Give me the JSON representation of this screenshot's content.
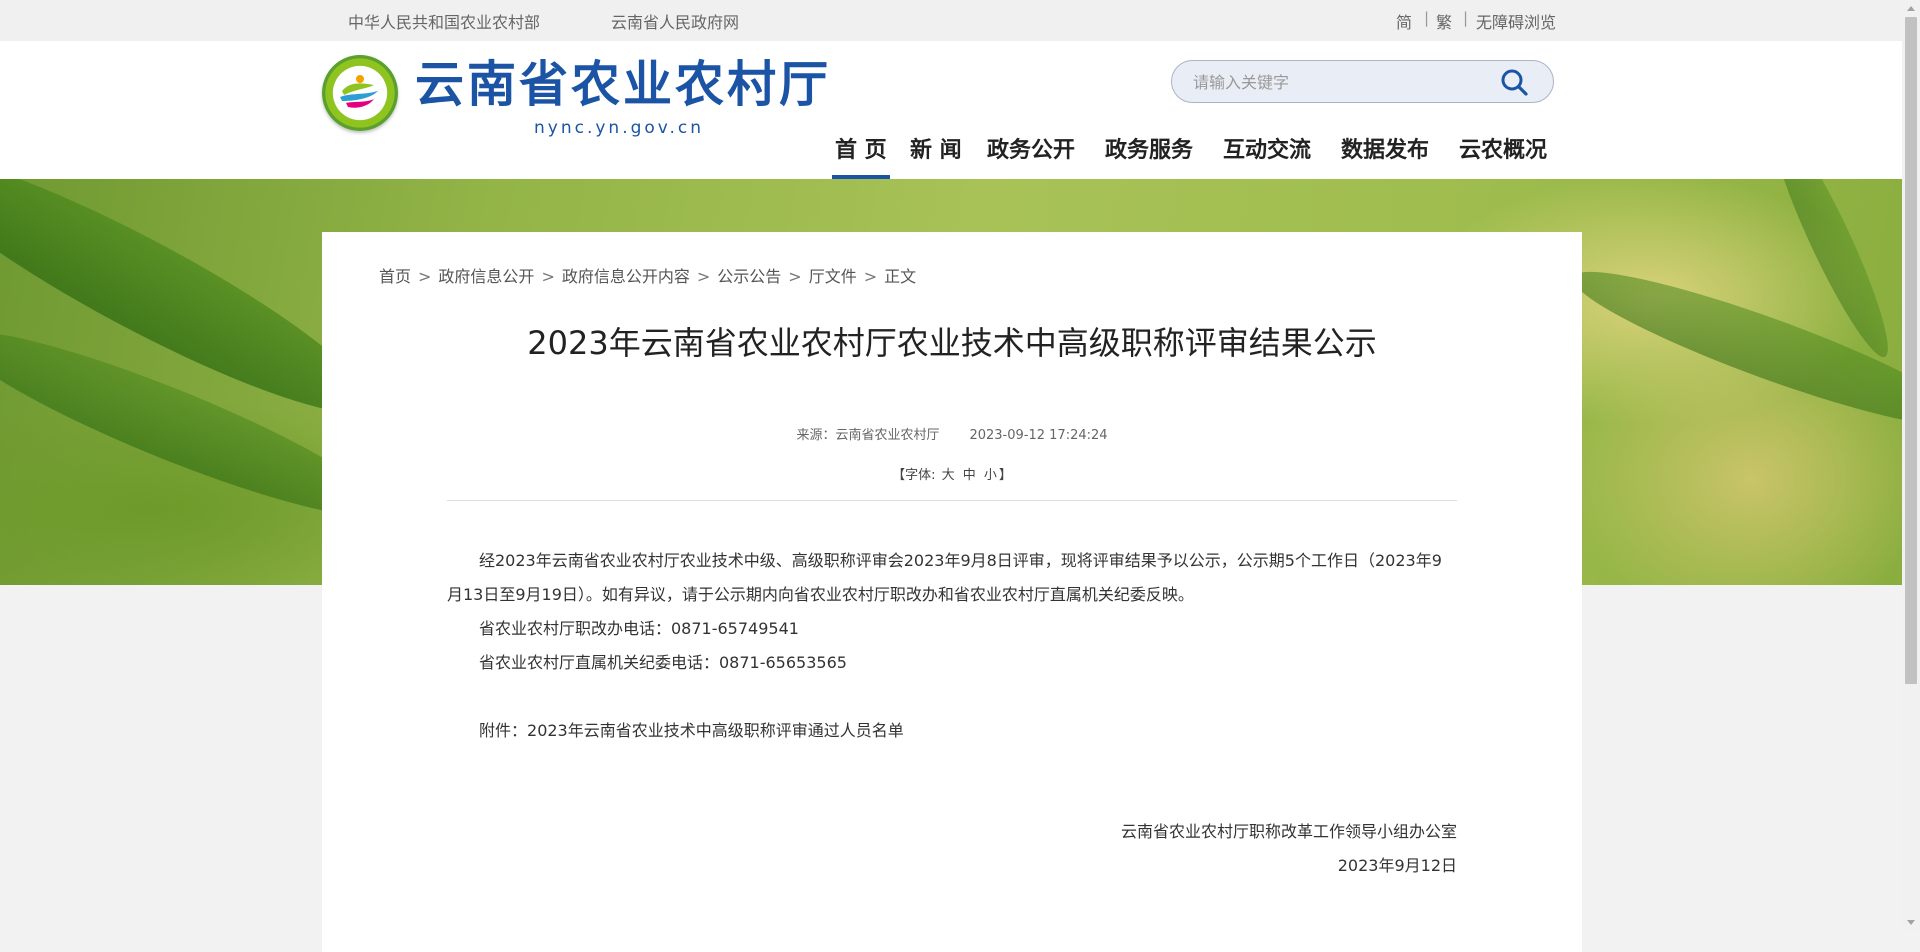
{
  "topbar": {
    "left_links": [
      "中华人民共和国农业农村部",
      "云南省人民政府网"
    ],
    "right_links": [
      "简",
      "繁",
      "无障碍浏览"
    ],
    "separator": "|"
  },
  "header": {
    "title": "云南省农业农村厅",
    "domain": "nync.yn.gov.cn",
    "logo_icon": "yunnan-agriculture-emblem-icon"
  },
  "search": {
    "placeholder": "请输入关键字",
    "value": "",
    "icon": "search-icon"
  },
  "nav": {
    "items": [
      "首 页",
      "新 闻",
      "政务公开",
      "政务服务",
      "互动交流",
      "数据发布",
      "云农概况"
    ],
    "active_index": 0
  },
  "breadcrumb": {
    "items": [
      "首页",
      "政府信息公开",
      "政府信息公开内容",
      "公示公告",
      "厅文件",
      "正文"
    ],
    "separator": ">"
  },
  "article": {
    "title": "2023年云南省农业农村厅农业技术中高级职称评审结果公示",
    "source_label": "来源：云南省农业农村厅",
    "datetime": "2023-09-12 17:24:24",
    "font_label_prefix": "【字体:",
    "font_options": [
      "大",
      "中",
      "小"
    ],
    "font_label_suffix": "】",
    "paragraphs": [
      "经2023年云南省农业农村厅农业技术中级、高级职称评审会2023年9月8日评审，现将评审结果予以公示，公示期5个工作日（2023年9月13日至9月19日）。如有异议，请于公示期内向省农业农村厅职改办和省农业农村厅直属机关纪委反映。",
      "省农业农村厅职改办电话：0871-65749541",
      "省农业农村厅直属机关纪委电话：0871-65653565"
    ],
    "attachment_label": "附件：",
    "attachment_link": "2023年云南省农业技术中高级职称评审通过人员名单",
    "signature": "云南省农业农村厅职称改革工作领导小组办公室",
    "signature_date": "2023年9月12日"
  },
  "colors": {
    "brand_blue": "#1b53a5",
    "banner_green": "#93b447",
    "page_bg": "#f2f2f2"
  }
}
